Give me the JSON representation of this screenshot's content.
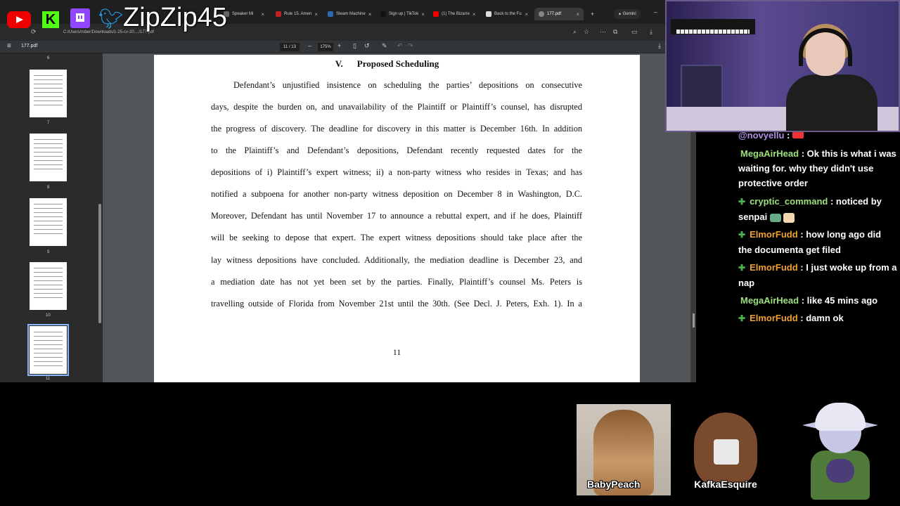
{
  "browser": {
    "tabs": [
      {
        "label": "Speaker Mi"
      },
      {
        "label": "Rule 15. Amen"
      },
      {
        "label": "Steam Machine"
      },
      {
        "label": "Sign up | TikTok"
      },
      {
        "label": "(1) The Bizarre"
      },
      {
        "label": "Back to the Fu"
      },
      {
        "label": "177.pdf",
        "active": true
      }
    ],
    "gemini_label": "Gemini",
    "url": "C:/Users/rober/Downloads/1-25-cv-20..../177.pdf"
  },
  "pdf": {
    "filename": "177.pdf",
    "page_display": "11 / 13",
    "zoom": "175%",
    "thumbnails": [
      {
        "number": "6"
      },
      {
        "number": "7"
      },
      {
        "number": "8"
      },
      {
        "number": "9"
      },
      {
        "number": "10"
      },
      {
        "number": "11",
        "selected": true
      }
    ],
    "section_number": "V.",
    "section_title": "Proposed Scheduling",
    "lines": [
      "Defendant’s unjustified insistence on scheduling the parties’ depositions on consecutive",
      "days, despite the burden on, and unavailability of the Plaintiff or Plaintiff’s counsel, has disrupted",
      "the progress of discovery. The deadline for discovery in this matter is December 16th. In addition",
      "to the Plaintiff’s and Defendant’s depositions, Defendant recently requested dates for the",
      "depositions of i) Plaintiff’s expert witness; ii) a non-party witness who resides in Texas; and has",
      "notified a subpoena for another non-party witness deposition on December 8 in Washington, D.C.",
      "Moreover, Defendant has until November 17 to announce a rebuttal expert, and if he does, Plaintiff",
      "will be seeking to depose that expert. The expert witness depositions should take place after the",
      "lay witness depositions have concluded. Additionally, the mediation deadline is December 23, and",
      "a mediation date has not yet been set by the parties. Finally, Plaintiff’s counsel Ms. Peters is",
      "travelling outside of Florida from November 21st until the 30th. (See Decl. J. Peters, Exh. 1). In a"
    ],
    "page_number": "11"
  },
  "overlay": {
    "channel_name": "ZipZip45",
    "kick_letter": "K"
  },
  "chat": {
    "messages": [
      {
        "user": "@novyellu",
        "text": "",
        "color": "#b090e0",
        "icon": false
      },
      {
        "user": "MegaAirHead",
        "text": "Ok this is what i was waiting for. why they didn't use protective order",
        "color": "#9de07e",
        "icon": false
      },
      {
        "user": "cryptic_command",
        "text": "noticed by senpai",
        "color": "#9de07e",
        "icon": true
      },
      {
        "user": "ElmorFudd",
        "text": "how long ago did the documenta get filed",
        "color": "#f0a030",
        "icon": true
      },
      {
        "user": "ElmorFudd",
        "text": "I just woke up from a nap",
        "color": "#f0a030",
        "icon": true
      },
      {
        "user": "MegaAirHead",
        "text": "like 45 mins ago",
        "color": "#9de07e",
        "icon": false
      },
      {
        "user": "ElmorFudd",
        "text": "damn ok",
        "color": "#f0a030",
        "icon": true
      }
    ]
  },
  "guests": [
    {
      "name": "BabyPeach"
    },
    {
      "name": "KafkaEsquire"
    }
  ]
}
